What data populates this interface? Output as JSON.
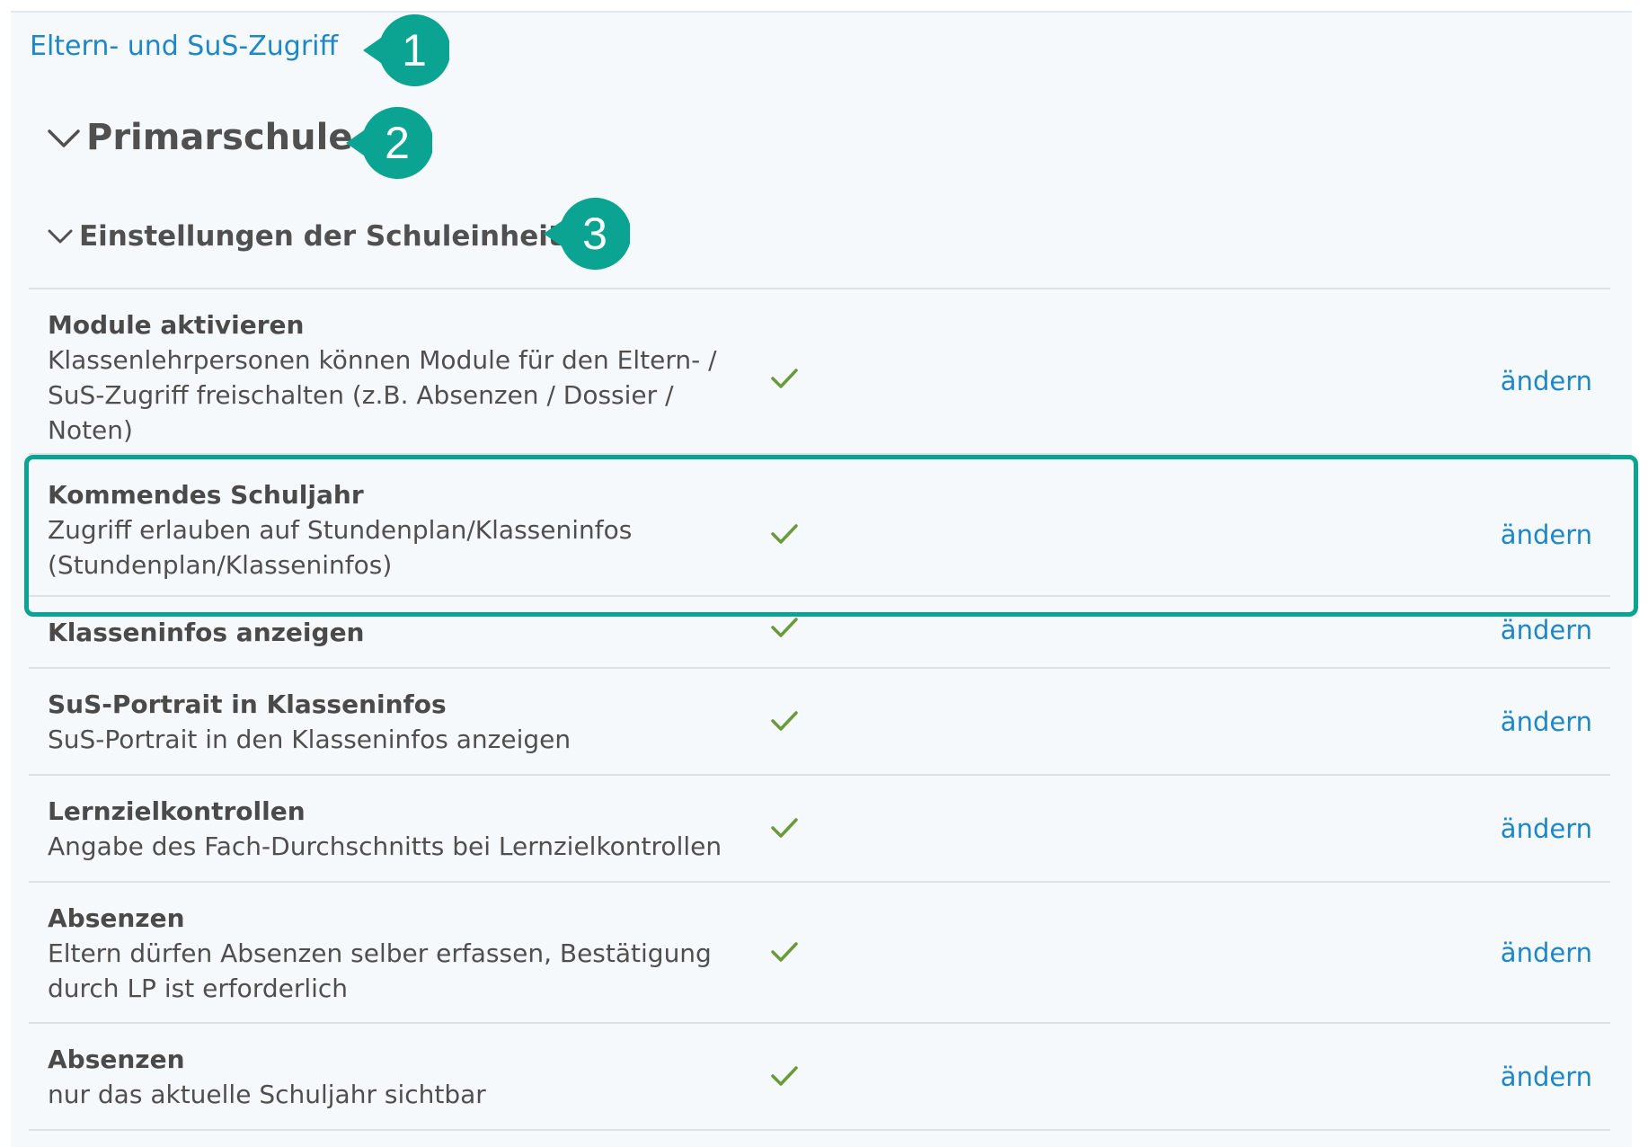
{
  "breadcrumb": {
    "label": "Eltern- und SuS-Zugriff"
  },
  "section": {
    "title": "Primarschule"
  },
  "subsection": {
    "title": "Einstellungen der Schuleinheit"
  },
  "settings": [
    {
      "title": "Module aktivieren",
      "description": "Klassenlehrpersonen können Module für den Eltern- / SuS-Zugriff freischalten (z.B. Absenzen / Dossier / Noten)",
      "enabled": true,
      "action": "ändern"
    },
    {
      "title": "Kommendes Schuljahr",
      "description": "Zugriff erlauben auf Stundenplan/Klasseninfos (Stundenplan/Klasseninfos)",
      "enabled": true,
      "action": "ändern"
    },
    {
      "title": "Klasseninfos anzeigen",
      "description": "",
      "enabled": true,
      "action": "ändern"
    },
    {
      "title": "SuS-Portrait in Klasseninfos",
      "description": "SuS-Portrait in den Klasseninfos anzeigen",
      "enabled": true,
      "action": "ändern"
    },
    {
      "title": "Lernzielkontrollen",
      "description": "Angabe des Fach-Durchschnitts bei Lernzielkontrollen",
      "enabled": true,
      "action": "ändern"
    },
    {
      "title": "Absenzen",
      "description": "Eltern dürfen Absenzen selber erfassen, Bestätigung durch LP ist erforderlich",
      "enabled": true,
      "action": "ändern"
    },
    {
      "title": "Absenzen",
      "description": "nur das aktuelle Schuljahr sichtbar",
      "enabled": true,
      "action": "ändern"
    }
  ],
  "annotations": {
    "marker1": "1",
    "marker2": "2",
    "marker3": "3"
  },
  "icons": {
    "chevron": "chevron-down-icon",
    "check": "check-icon"
  },
  "colors": {
    "link": "#1d87c8",
    "check": "#6a9a3a",
    "accent": "#0ba391",
    "panel": "#f6f9fb"
  }
}
